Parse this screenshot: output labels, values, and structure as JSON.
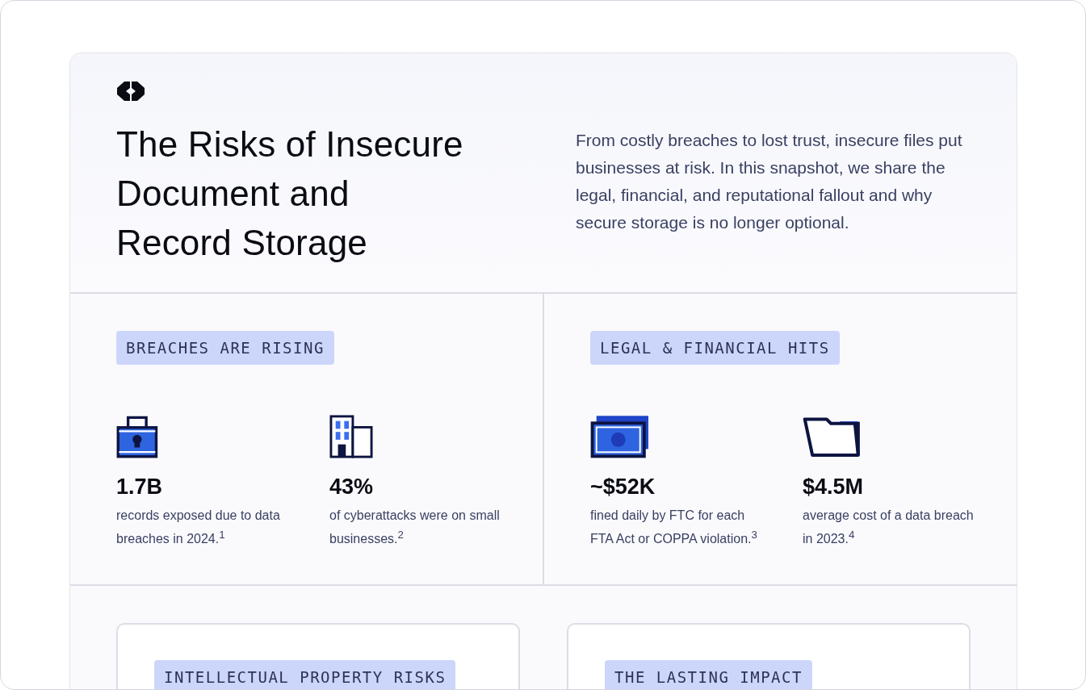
{
  "header": {
    "title": "The Risks of Insecure Document and Record Storage",
    "intro": "From costly breaches to lost trust, insecure files put businesses at risk. In this snapshot, we share the legal, financial, and reputational fallout and why secure storage is no longer optional."
  },
  "sections": [
    {
      "tag": "BREACHES ARE RISING",
      "stats": [
        {
          "kind": "lock",
          "value": "1.7B",
          "text": "records exposed due to data breaches in 2024.$^{1}$"
        },
        {
          "kind": "building",
          "value": "43%",
          "text": "of cyberattacks were on small businesses.$^{2}$"
        }
      ]
    },
    {
      "tag": "LEGAL & FINANCIAL HITS",
      "stats": [
        {
          "kind": "money",
          "value": "~$52K",
          "text": "fined daily by FTC for each FTA Act or COPPA violation.$^{3}$"
        },
        {
          "kind": "folder",
          "value": "$4.5M",
          "text": "average cost of a data breach in 2023.$^{4}$"
        }
      ]
    }
  ],
  "cards": [
    {
      "tag": "INTELLECTUAL PROPERTY RISKS"
    },
    {
      "tag": "THE LASTING IMPACT"
    }
  ]
}
